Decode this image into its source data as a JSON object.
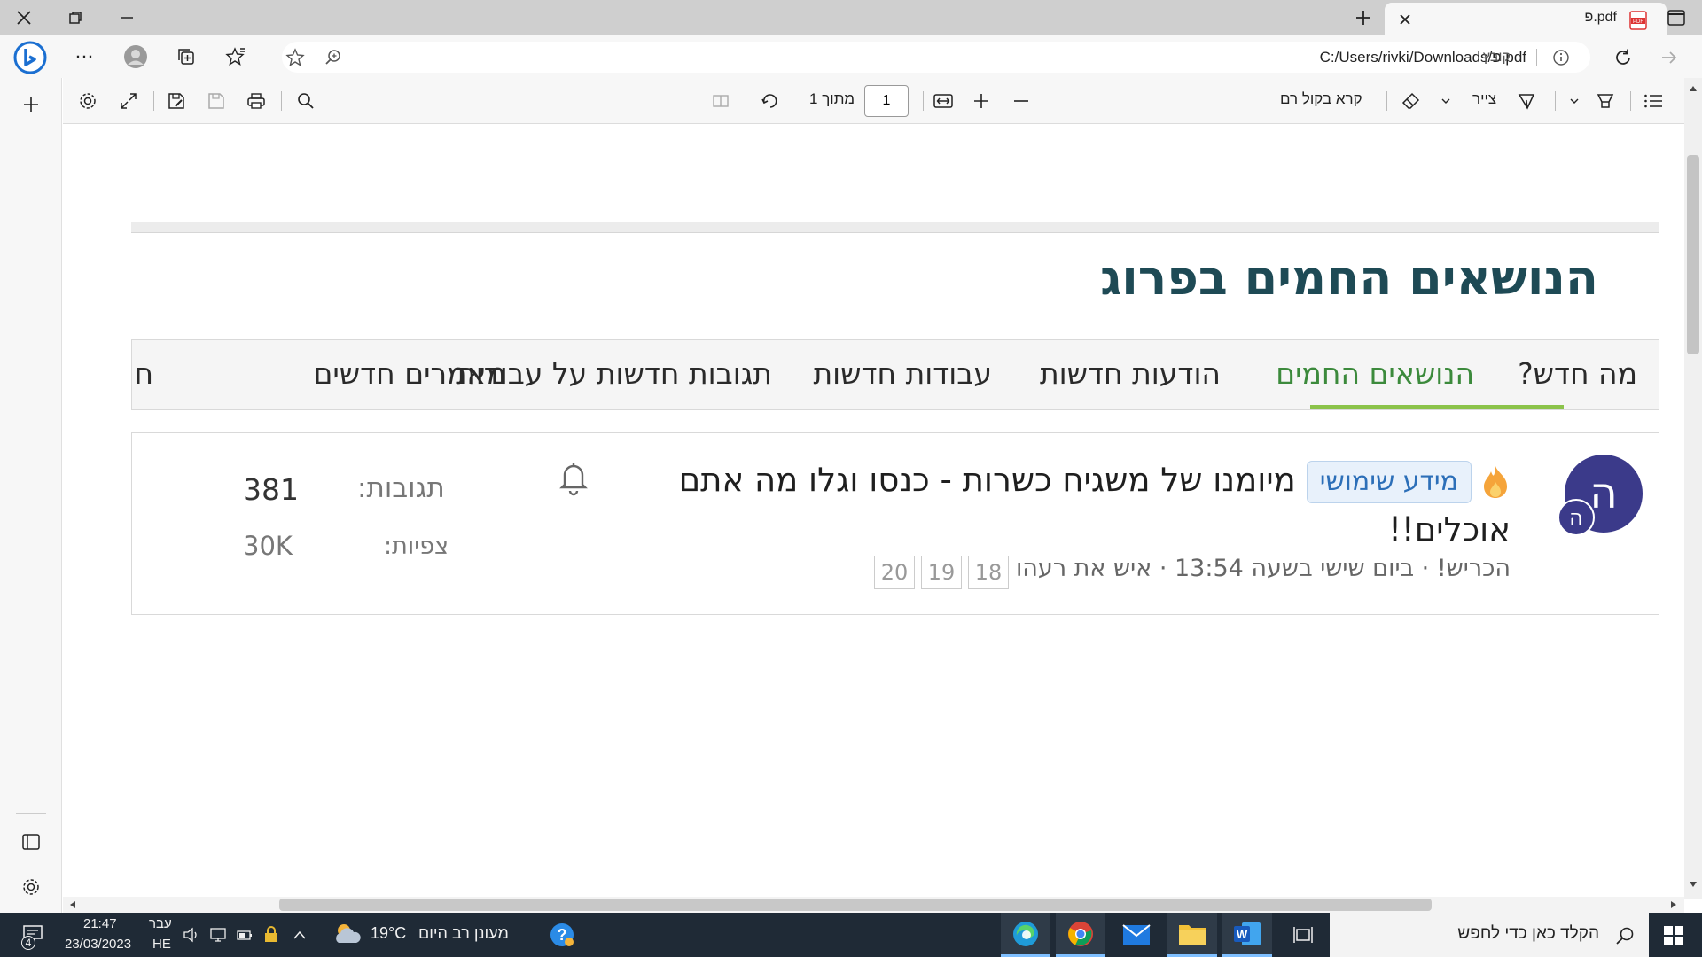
{
  "browser": {
    "tab_title": "פ.pdf",
    "url": "C:/Users/rivki/Downloads/פ.pdf",
    "file_label": "קובץ"
  },
  "pdf_toolbar": {
    "read_aloud": "קרא בקול רם",
    "draw": "צייר",
    "page_of": "מתוך 1",
    "page_current": "1"
  },
  "page": {
    "heading": "הנושאים החמים בפרוג",
    "tabs": [
      {
        "label": "מה חדש?"
      },
      {
        "label": "הנושאים החמים"
      },
      {
        "label": "הודעות חדשות"
      },
      {
        "label": "עבודות חדשות"
      },
      {
        "label": "תגובות חדשות על עבודות"
      },
      {
        "label": "מאמרים חדשים"
      },
      {
        "label": "ח"
      }
    ],
    "topic": {
      "avatar_letter": "ה",
      "avatar_small_letter": "ה",
      "badge": "מידע שימושי",
      "title": "מיומנו של משגיח כשרות - כנסו וגלו מה אתם אוכלים!!",
      "meta": "הכריש! · ביום שישי בשעה 13:54 · איש את רעהו",
      "pages": [
        "18",
        "19",
        "20"
      ],
      "replies_label": "תגובות:",
      "replies_value": "381",
      "views_label": "צפיות:",
      "views_value": "30K"
    }
  },
  "taskbar": {
    "search_placeholder": "הקלד כאן כדי לחפש",
    "weather_temp": "19°C",
    "weather_text": "מעונן רב היום",
    "time": "21:47",
    "date": "23/03/2023",
    "lang_top": "עבר",
    "lang_bottom": "HE",
    "notification_count": "4"
  }
}
